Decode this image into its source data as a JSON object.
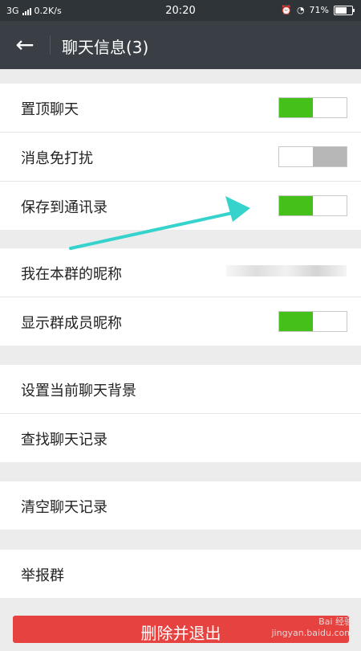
{
  "status_bar": {
    "network": "3G",
    "speed": "0.2K/s",
    "time": "20:20",
    "battery": "71%",
    "battery_level": 0.71
  },
  "header": {
    "title": "聊天信息(3)"
  },
  "group1": [
    {
      "label": "置顶聊天",
      "toggle": "on"
    },
    {
      "label": "消息免打扰",
      "toggle": "off"
    },
    {
      "label": "保存到通讯录",
      "toggle": "on"
    }
  ],
  "group2": [
    {
      "label": "我在本群的昵称"
    },
    {
      "label": "显示群成员昵称",
      "toggle": "on"
    }
  ],
  "group3": [
    {
      "label": "设置当前聊天背景"
    },
    {
      "label": "查找聊天记录"
    }
  ],
  "group4": [
    {
      "label": "清空聊天记录"
    }
  ],
  "group5": [
    {
      "label": "举报群"
    }
  ],
  "bottom_button": {
    "label": "删除并退出"
  },
  "watermark": {
    "brand": "Bai 经验",
    "url": "jingyan.baidu.com"
  },
  "colors": {
    "toggle_on": "#45c01a",
    "toggle_off": "#b7b7b7",
    "danger": "#e64340",
    "annotation": "#35d3cc"
  }
}
